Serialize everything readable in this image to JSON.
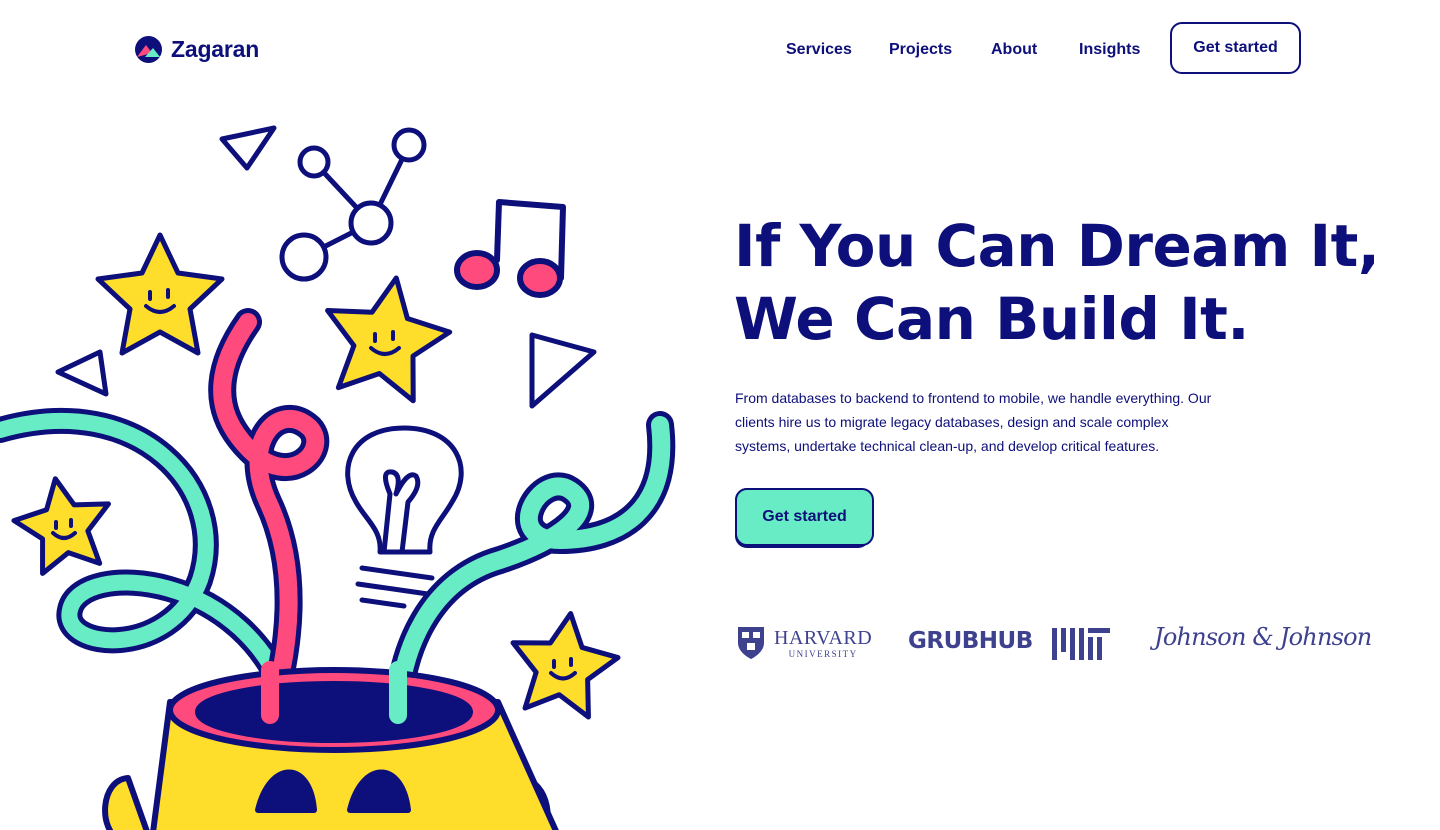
{
  "brand": {
    "name": "Zagaran",
    "logo_icon": "mountain-circle-icon"
  },
  "nav": {
    "items": [
      "Services",
      "Projects",
      "About",
      "Insights"
    ],
    "cta": "Get started"
  },
  "hero": {
    "title_line1": "If You Can Dream It,",
    "title_line2": "We Can Build It.",
    "description": "From databases to backend to frontend to mobile, we handle everything. Our clients hire us to migrate legacy databases, design and scale complex systems, undertake technical clean-up, and develop critical features.",
    "cta": "Get started"
  },
  "clients": {
    "harvard": {
      "name": "HARVARD",
      "sub": "UNIVERSITY",
      "icon": "harvard-shield-icon"
    },
    "grubhub": {
      "name": "GRUBHUB"
    },
    "mit": {
      "name": "MIT"
    },
    "jnj": {
      "name": "Johnson & Johnson"
    }
  },
  "colors": {
    "navy": "#0d0f7a",
    "mint": "#68ecc5",
    "pink": "#ff4a7d",
    "yellow": "#ffde2b",
    "logo_gray": "#3e418e",
    "background": "#ffffff"
  }
}
